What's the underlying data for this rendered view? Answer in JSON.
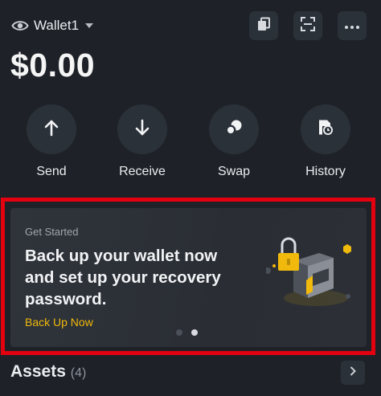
{
  "header": {
    "wallet_name": "Wallet1",
    "icons": [
      "eye-icon",
      "caret-down-icon",
      "copy-icon",
      "scan-icon",
      "more-icon"
    ]
  },
  "balance": "$0.00",
  "actions": [
    {
      "label": "Send",
      "icon": "arrow-up-icon"
    },
    {
      "label": "Receive",
      "icon": "arrow-down-icon"
    },
    {
      "label": "Swap",
      "icon": "swap-icon"
    },
    {
      "label": "History",
      "icon": "history-icon"
    }
  ],
  "banner": {
    "kicker": "Get Started",
    "title": "Back up your wallet now and set up your recovery password.",
    "link": "Back Up Now",
    "pages": 2,
    "active_page": 2,
    "illustration": "wallet-lock-illustration",
    "highlight_color": "#e3000f"
  },
  "assets": {
    "title": "Assets",
    "count": "(4)"
  },
  "colors": {
    "background": "#1e2228",
    "surface": "#2b3139",
    "accent": "#f0b90b",
    "text": "#eaecef",
    "muted": "#8d949e"
  }
}
